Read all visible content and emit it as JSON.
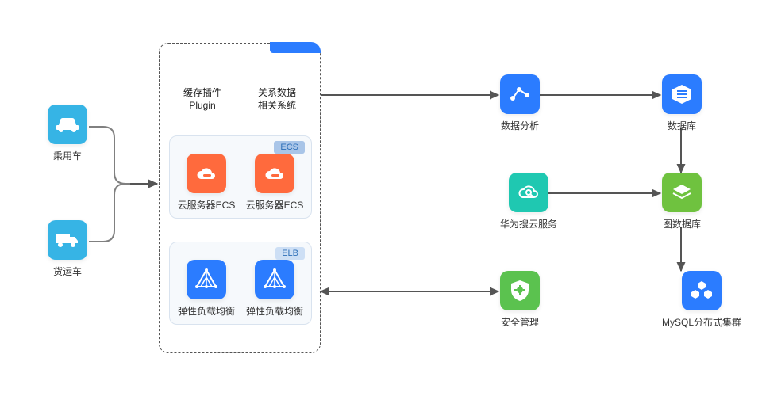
{
  "left": {
    "car": "乘用车",
    "truck": "货运车"
  },
  "center": {
    "head1": {
      "line1": "缓存插件",
      "line2": "Plugin"
    },
    "head2": {
      "line1": "关系数据",
      "line2": "相关系统"
    },
    "ecs": {
      "badge": "ECS",
      "item": "云服务器ECS"
    },
    "elb": {
      "badge": "ELB",
      "item": "弹性负载均衡"
    }
  },
  "right": {
    "analytics": "数据分析",
    "cloudSearch": "华为搜云服务",
    "security": "安全管理",
    "datastoreTop": "数据库",
    "middleStack": "图数据库",
    "mysqlCluster": "MySQL分布式集群"
  }
}
